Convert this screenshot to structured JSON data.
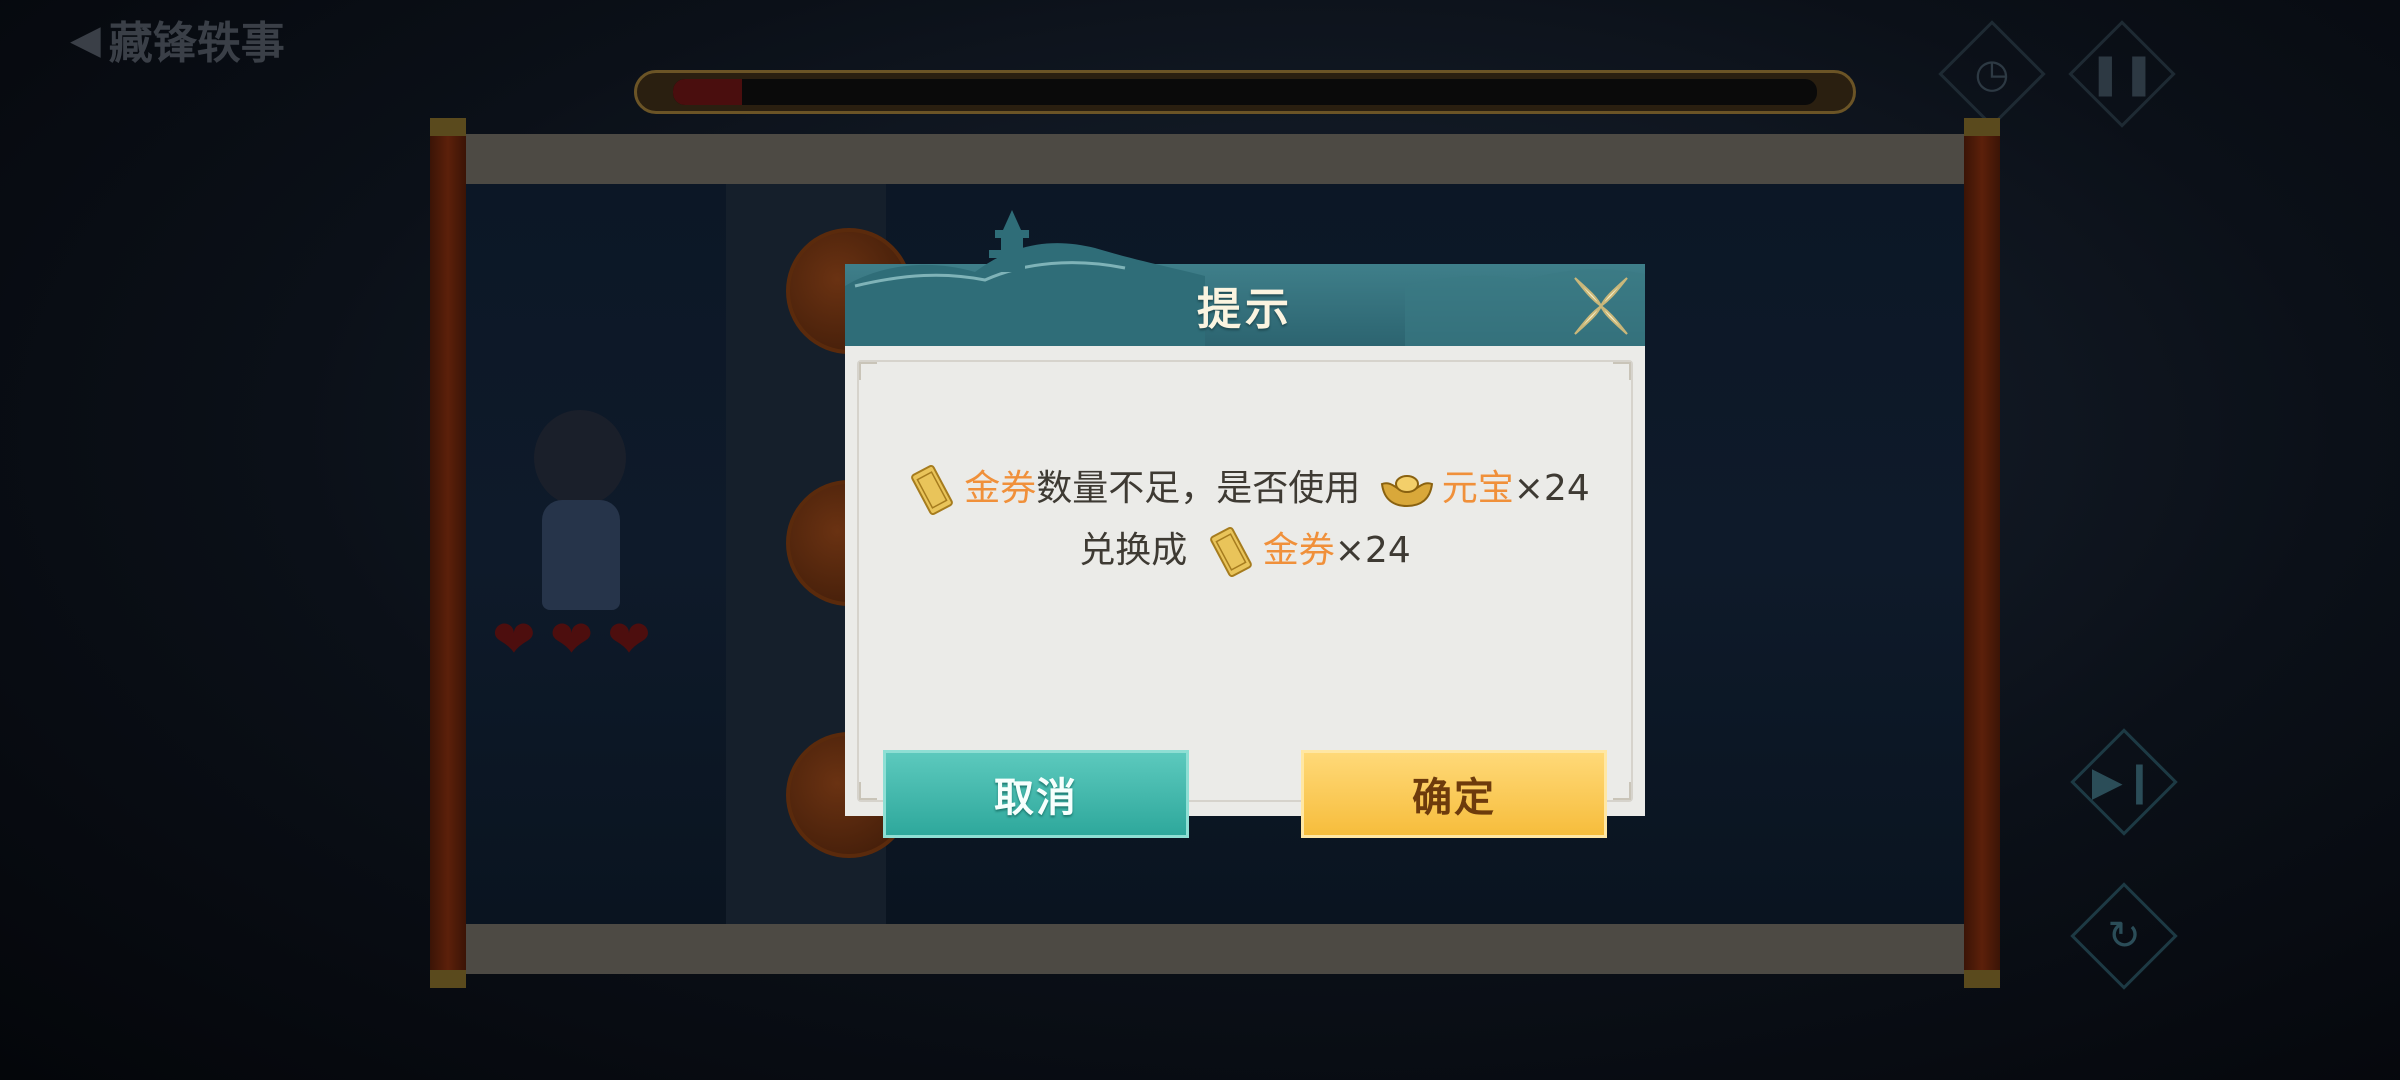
{
  "header": {
    "back_label": "藏锋轶事"
  },
  "progress": {
    "fraction": 0.06
  },
  "hud": {
    "left_icons": [
      "clock-icon",
      "pause-icon"
    ],
    "right_icons": [
      "skip-icon",
      "replay-icon"
    ]
  },
  "player": {
    "hearts": 3
  },
  "dialog": {
    "title": "提示",
    "line1_item": "金券",
    "line1_text": "数量不足，是否使用",
    "line1_currency": "元宝",
    "line1_qty": "×24",
    "line2_prefix": "兑换成",
    "line2_item": "金券",
    "line2_qty": "×24",
    "cancel_label": "取消",
    "confirm_label": "确定"
  },
  "colors": {
    "highlight": "#f0903a",
    "header_teal": "#2c6470",
    "cancel_teal": "#2ea89c",
    "confirm_gold": "#f6bd3c"
  }
}
